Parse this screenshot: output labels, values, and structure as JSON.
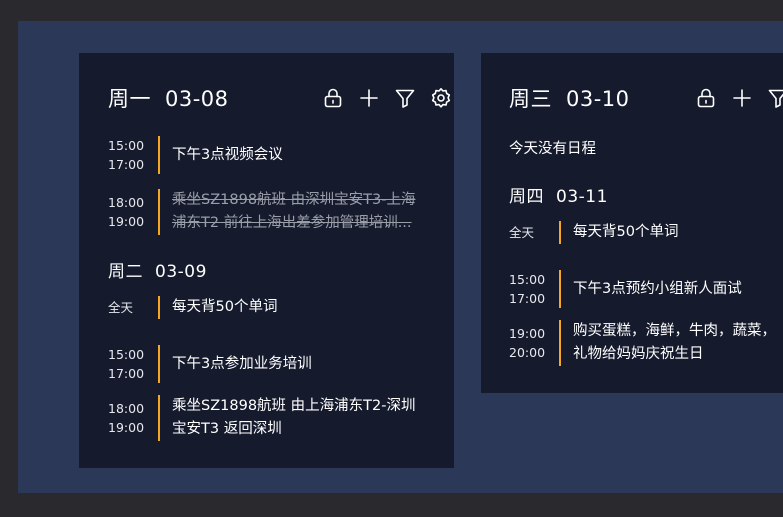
{
  "columns": [
    {
      "weekday": "周一",
      "date": "03-08",
      "events": [
        {
          "start": "15:00",
          "end": "17:00",
          "lines": [
            "下午3点视频会议"
          ],
          "done": false
        },
        {
          "start": "18:00",
          "end": "19:00",
          "lines": [
            "乘坐SZ1898航班 由深圳宝安T3-上海",
            "浦东T2 前往上海出差参加管理培训..."
          ],
          "done": true
        }
      ],
      "next_day": {
        "weekday": "周二",
        "date": "03-09",
        "events": [
          {
            "allday": "全天",
            "lines": [
              "每天背50个单词"
            ]
          },
          {
            "start": "15:00",
            "end": "17:00",
            "lines": [
              "下午3点参加业务培训"
            ]
          },
          {
            "start": "18:00",
            "end": "19:00",
            "lines": [
              "乘坐SZ1898航班 由上海浦东T2-深圳",
              "宝安T3 返回深圳"
            ]
          }
        ]
      }
    },
    {
      "weekday": "周三",
      "date": "03-10",
      "empty_text": "今天没有日程",
      "next_day": {
        "weekday": "周四",
        "date": "03-11",
        "events": [
          {
            "allday": "全天",
            "lines": [
              "每天背50个单词"
            ]
          },
          {
            "start": "15:00",
            "end": "17:00",
            "lines": [
              "下午3点预约小组新人面试"
            ]
          },
          {
            "start": "19:00",
            "end": "20:00",
            "lines": [
              "购买蛋糕，海鲜，牛肉，蔬菜，",
              "礼物给妈妈庆祝生日"
            ]
          }
        ]
      }
    }
  ],
  "icons": [
    "lock-icon",
    "plus-icon",
    "filter-icon",
    "settings-icon"
  ],
  "colors": {
    "outer_bg": "#2a2a2e",
    "stage_bg": "#2c3857",
    "card_bg": "#151b2d",
    "accent_bar": "#f5a623",
    "done_text": "#9a9ea8"
  }
}
